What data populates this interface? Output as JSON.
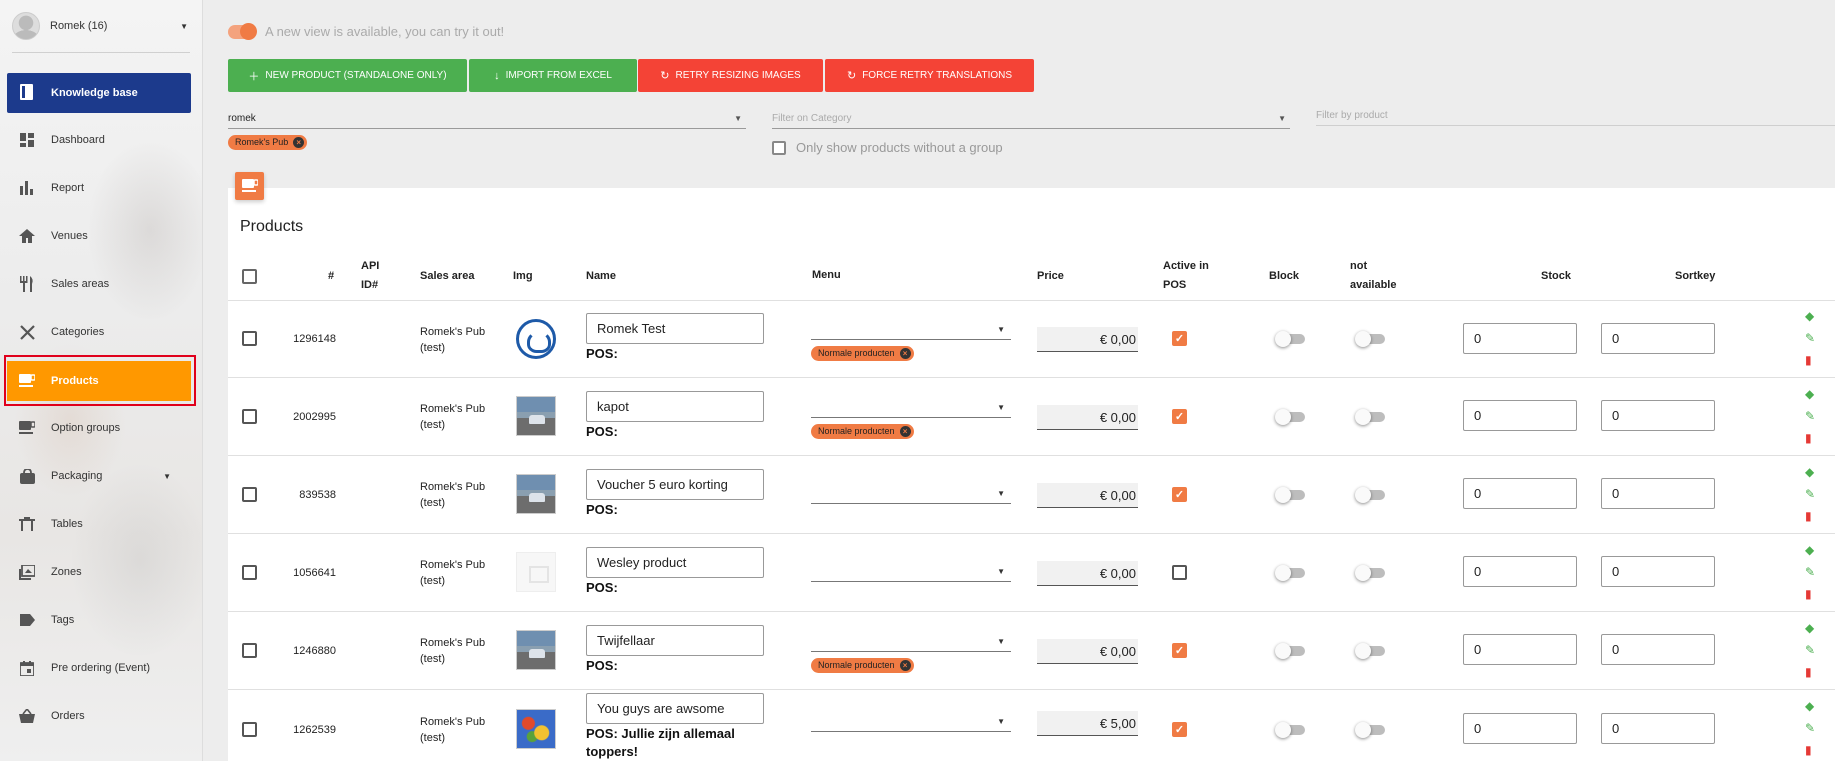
{
  "user": {
    "name": "Romek (16)"
  },
  "sidebar": {
    "knowledge_base": "Knowledge base",
    "items": [
      {
        "label": "Dashboard",
        "icon": "dashboard-icon"
      },
      {
        "label": "Report",
        "icon": "bar-chart-icon"
      },
      {
        "label": "Venues",
        "icon": "home-icon"
      },
      {
        "label": "Sales areas",
        "icon": "restaurant-icon"
      },
      {
        "label": "Categories",
        "icon": "utensils-cross-icon"
      },
      {
        "label": "Products",
        "icon": "coffee-icon",
        "active": true
      },
      {
        "label": "Option groups",
        "icon": "coffee-plus-icon"
      },
      {
        "label": "Packaging",
        "icon": "bag-icon"
      },
      {
        "label": "Tables",
        "icon": "table-icon"
      },
      {
        "label": "Zones",
        "icon": "zone-icon"
      },
      {
        "label": "Tags",
        "icon": "tag-icon"
      },
      {
        "label": "Pre ordering (Event)",
        "icon": "calendar-icon"
      },
      {
        "label": "Orders",
        "icon": "basket-icon"
      }
    ]
  },
  "banner": {
    "text": "A new view is available, you can try it out!"
  },
  "toolbar": {
    "new_product": "NEW PRODUCT (STANDALONE ONLY)",
    "import_excel": "IMPORT FROM EXCEL",
    "retry_resizing": "RETRY RESIZING IMAGES",
    "force_translations": "FORCE RETRY TRANSLATIONS"
  },
  "filters": {
    "venue_value": "romek",
    "venue_chip": "Romek's Pub",
    "category_placeholder": "Filter on Category",
    "product_placeholder": "Filter by product",
    "no_group_label": "Only show products without a group"
  },
  "products": {
    "title": "Products",
    "columns": {
      "hash": "#",
      "api_id": "API ID#",
      "sales_area": "Sales area",
      "img": "Img",
      "name": "Name",
      "menu": "Menu",
      "price": "Price",
      "active_pos": "Active in POS",
      "block": "Block",
      "not_available": "not available",
      "stock": "Stock",
      "sortkey": "Sortkey"
    },
    "rows": [
      {
        "id": "1296148",
        "area": "Romek's Pub (test)",
        "img": "logo",
        "name": "Romek Test",
        "pos": "POS:",
        "menu_chip": "Normale producten",
        "price": "€ 0,00",
        "active": true,
        "stock": "0",
        "sortkey": "0"
      },
      {
        "id": "2002995",
        "area": "Romek's Pub (test)",
        "img": "car",
        "name": "kapot",
        "pos": "POS:",
        "menu_chip": "Normale producten",
        "price": "€ 0,00",
        "active": true,
        "stock": "0",
        "sortkey": "0"
      },
      {
        "id": "839538",
        "area": "Romek's Pub (test)",
        "img": "car",
        "name": "Voucher 5 euro korting",
        "pos": "POS:",
        "menu_chip": "",
        "price": "€ 0,00",
        "active": true,
        "stock": "0",
        "sortkey": "0"
      },
      {
        "id": "1056641",
        "area": "Romek's Pub (test)",
        "img": "blank",
        "name": "Wesley product",
        "pos": "POS:",
        "menu_chip": "",
        "price": "€ 0,00",
        "active": false,
        "stock": "0",
        "sortkey": "0"
      },
      {
        "id": "1246880",
        "area": "Romek's Pub (test)",
        "img": "car",
        "name": "Twijfellaar",
        "pos": "POS:",
        "menu_chip": "Normale producten",
        "price": "€ 0,00",
        "active": true,
        "stock": "0",
        "sortkey": "0"
      },
      {
        "id": "1262539",
        "area": "Romek's Pub (test)",
        "img": "food",
        "name": "You guys are awsome",
        "pos": "POS: Jullie zijn allemaal toppers!",
        "menu_chip": "",
        "price": "€ 5,00",
        "active": true,
        "stock": "0",
        "sortkey": "0"
      }
    ]
  },
  "colors": {
    "primary": "#1c3a8c",
    "active": "#ff9800",
    "accent": "#f07b44",
    "green": "#4caf50",
    "red": "#f44336"
  }
}
